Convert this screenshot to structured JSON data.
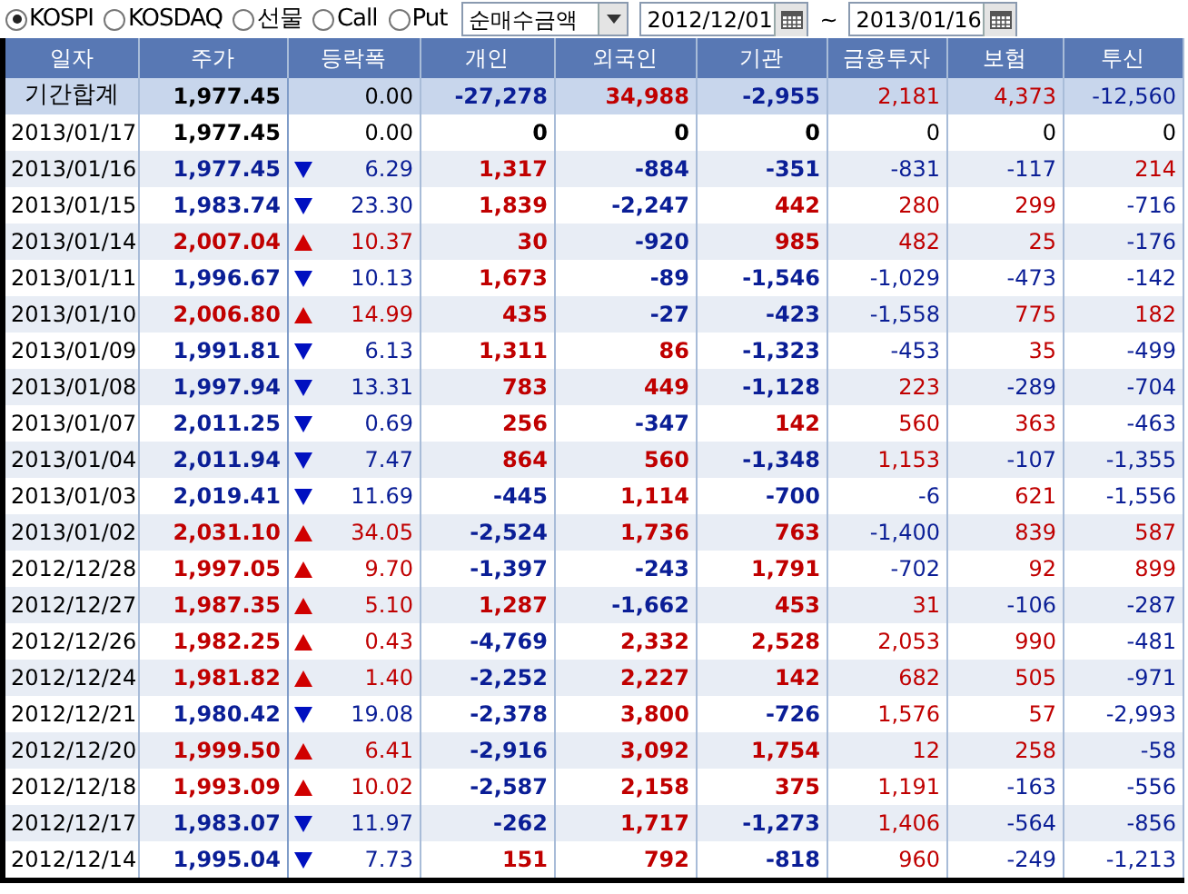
{
  "market_options": [
    {
      "label": "KOSPI",
      "selected": true
    },
    {
      "label": "KOSDAQ",
      "selected": false
    },
    {
      "label": "선물",
      "selected": false
    },
    {
      "label": "Call",
      "selected": false
    },
    {
      "label": "Put",
      "selected": false
    }
  ],
  "measure_select": {
    "value": "순매수금액"
  },
  "date_from": {
    "value": "2012/12/01"
  },
  "range_separator": "~",
  "date_to": {
    "value": "2013/01/16"
  },
  "table": {
    "columns": [
      "일자",
      "주가",
      "등락폭",
      "개인",
      "외국인",
      "기관",
      "금융투자",
      "보험",
      "투신"
    ],
    "rows": [
      {
        "kind": "total",
        "date": "기간합계",
        "price": "1,977.45",
        "up": false,
        "down": false,
        "change": "0.00",
        "values": [
          "-27,278",
          "34,988",
          "-2,955",
          "2,181",
          "4,373",
          "-12,560"
        ]
      },
      {
        "kind": "day",
        "date": "2013/01/17",
        "price": "1,977.45",
        "up": false,
        "down": false,
        "change": "0.00",
        "values": [
          "0",
          "0",
          "0",
          "0",
          "0",
          "0"
        ]
      },
      {
        "kind": "day",
        "date": "2013/01/16",
        "price": "1,977.45",
        "up": false,
        "down": true,
        "change": "6.29",
        "values": [
          "1,317",
          "-884",
          "-351",
          "-831",
          "-117",
          "214"
        ]
      },
      {
        "kind": "day",
        "date": "2013/01/15",
        "price": "1,983.74",
        "up": false,
        "down": true,
        "change": "23.30",
        "values": [
          "1,839",
          "-2,247",
          "442",
          "280",
          "299",
          "-716"
        ]
      },
      {
        "kind": "day",
        "date": "2013/01/14",
        "price": "2,007.04",
        "up": true,
        "down": false,
        "change": "10.37",
        "values": [
          "30",
          "-920",
          "985",
          "482",
          "25",
          "-176"
        ]
      },
      {
        "kind": "day",
        "date": "2013/01/11",
        "price": "1,996.67",
        "up": false,
        "down": true,
        "change": "10.13",
        "values": [
          "1,673",
          "-89",
          "-1,546",
          "-1,029",
          "-473",
          "-142"
        ]
      },
      {
        "kind": "day",
        "date": "2013/01/10",
        "price": "2,006.80",
        "up": true,
        "down": false,
        "change": "14.99",
        "values": [
          "435",
          "-27",
          "-423",
          "-1,558",
          "775",
          "182"
        ]
      },
      {
        "kind": "day",
        "date": "2013/01/09",
        "price": "1,991.81",
        "up": false,
        "down": true,
        "change": "6.13",
        "values": [
          "1,311",
          "86",
          "-1,323",
          "-453",
          "35",
          "-499"
        ]
      },
      {
        "kind": "day",
        "date": "2013/01/08",
        "price": "1,997.94",
        "up": false,
        "down": true,
        "change": "13.31",
        "values": [
          "783",
          "449",
          "-1,128",
          "223",
          "-289",
          "-704"
        ]
      },
      {
        "kind": "day",
        "date": "2013/01/07",
        "price": "2,011.25",
        "up": false,
        "down": true,
        "change": "0.69",
        "values": [
          "256",
          "-347",
          "142",
          "560",
          "363",
          "-463"
        ]
      },
      {
        "kind": "day",
        "date": "2013/01/04",
        "price": "2,011.94",
        "up": false,
        "down": true,
        "change": "7.47",
        "values": [
          "864",
          "560",
          "-1,348",
          "1,153",
          "-107",
          "-1,355"
        ]
      },
      {
        "kind": "day",
        "date": "2013/01/03",
        "price": "2,019.41",
        "up": false,
        "down": true,
        "change": "11.69",
        "values": [
          "-445",
          "1,114",
          "-700",
          "-6",
          "621",
          "-1,556"
        ]
      },
      {
        "kind": "day",
        "date": "2013/01/02",
        "price": "2,031.10",
        "up": true,
        "down": false,
        "change": "34.05",
        "values": [
          "-2,524",
          "1,736",
          "763",
          "-1,400",
          "839",
          "587"
        ]
      },
      {
        "kind": "day",
        "date": "2012/12/28",
        "price": "1,997.05",
        "up": true,
        "down": false,
        "change": "9.70",
        "values": [
          "-1,397",
          "-243",
          "1,791",
          "-702",
          "92",
          "899"
        ]
      },
      {
        "kind": "day",
        "date": "2012/12/27",
        "price": "1,987.35",
        "up": true,
        "down": false,
        "change": "5.10",
        "values": [
          "1,287",
          "-1,662",
          "453",
          "31",
          "-106",
          "-287"
        ]
      },
      {
        "kind": "day",
        "date": "2012/12/26",
        "price": "1,982.25",
        "up": true,
        "down": false,
        "change": "0.43",
        "values": [
          "-4,769",
          "2,332",
          "2,528",
          "2,053",
          "990",
          "-481"
        ]
      },
      {
        "kind": "day",
        "date": "2012/12/24",
        "price": "1,981.82",
        "up": true,
        "down": false,
        "change": "1.40",
        "values": [
          "-2,252",
          "2,227",
          "142",
          "682",
          "505",
          "-971"
        ]
      },
      {
        "kind": "day",
        "date": "2012/12/21",
        "price": "1,980.42",
        "up": false,
        "down": true,
        "change": "19.08",
        "values": [
          "-2,378",
          "3,800",
          "-726",
          "1,576",
          "57",
          "-2,993"
        ]
      },
      {
        "kind": "day",
        "date": "2012/12/20",
        "price": "1,999.50",
        "up": true,
        "down": false,
        "change": "6.41",
        "values": [
          "-2,916",
          "3,092",
          "1,754",
          "12",
          "258",
          "-58"
        ]
      },
      {
        "kind": "day",
        "date": "2012/12/18",
        "price": "1,993.09",
        "up": true,
        "down": false,
        "change": "10.02",
        "values": [
          "-2,587",
          "2,158",
          "375",
          "1,191",
          "-163",
          "-556"
        ]
      },
      {
        "kind": "day",
        "date": "2012/12/17",
        "price": "1,983.07",
        "up": false,
        "down": true,
        "change": "11.97",
        "values": [
          "-262",
          "1,717",
          "-1,273",
          "1,406",
          "-564",
          "-856"
        ]
      },
      {
        "kind": "day",
        "date": "2012/12/14",
        "price": "1,995.04",
        "up": false,
        "down": true,
        "change": "7.73",
        "values": [
          "151",
          "792",
          "-818",
          "960",
          "-249",
          "-1,213"
        ]
      }
    ]
  }
}
